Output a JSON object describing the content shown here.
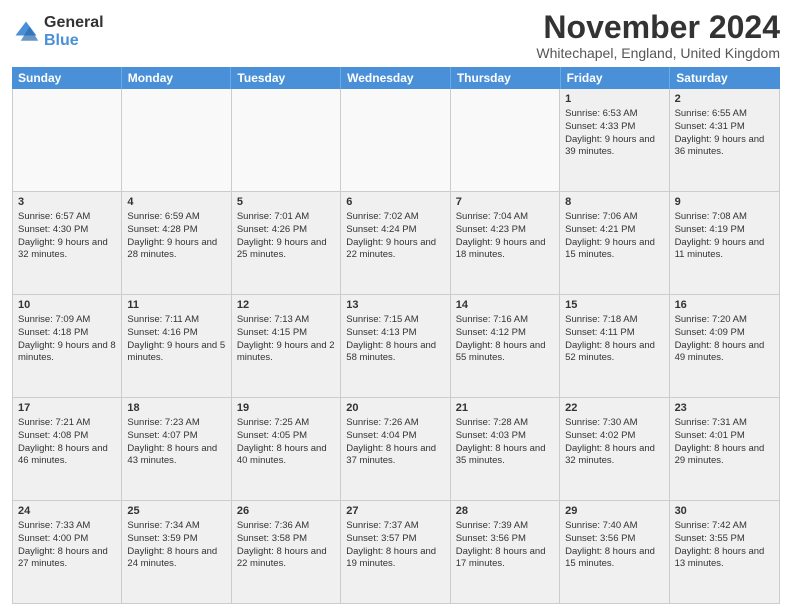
{
  "header": {
    "logo_general": "General",
    "logo_blue": "Blue",
    "month_title": "November 2024",
    "location": "Whitechapel, England, United Kingdom"
  },
  "days_of_week": [
    "Sunday",
    "Monday",
    "Tuesday",
    "Wednesday",
    "Thursday",
    "Friday",
    "Saturday"
  ],
  "weeks": [
    [
      {
        "day": "",
        "empty": true
      },
      {
        "day": "",
        "empty": true
      },
      {
        "day": "",
        "empty": true
      },
      {
        "day": "",
        "empty": true
      },
      {
        "day": "",
        "empty": true
      },
      {
        "day": "1",
        "sunrise": "6:53 AM",
        "sunset": "4:33 PM",
        "daylight": "9 hours and 39 minutes."
      },
      {
        "day": "2",
        "sunrise": "6:55 AM",
        "sunset": "4:31 PM",
        "daylight": "9 hours and 36 minutes."
      }
    ],
    [
      {
        "day": "3",
        "sunrise": "6:57 AM",
        "sunset": "4:30 PM",
        "daylight": "9 hours and 32 minutes."
      },
      {
        "day": "4",
        "sunrise": "6:59 AM",
        "sunset": "4:28 PM",
        "daylight": "9 hours and 28 minutes."
      },
      {
        "day": "5",
        "sunrise": "7:01 AM",
        "sunset": "4:26 PM",
        "daylight": "9 hours and 25 minutes."
      },
      {
        "day": "6",
        "sunrise": "7:02 AM",
        "sunset": "4:24 PM",
        "daylight": "9 hours and 22 minutes."
      },
      {
        "day": "7",
        "sunrise": "7:04 AM",
        "sunset": "4:23 PM",
        "daylight": "9 hours and 18 minutes."
      },
      {
        "day": "8",
        "sunrise": "7:06 AM",
        "sunset": "4:21 PM",
        "daylight": "9 hours and 15 minutes."
      },
      {
        "day": "9",
        "sunrise": "7:08 AM",
        "sunset": "4:19 PM",
        "daylight": "9 hours and 11 minutes."
      }
    ],
    [
      {
        "day": "10",
        "sunrise": "7:09 AM",
        "sunset": "4:18 PM",
        "daylight": "9 hours and 8 minutes."
      },
      {
        "day": "11",
        "sunrise": "7:11 AM",
        "sunset": "4:16 PM",
        "daylight": "9 hours and 5 minutes."
      },
      {
        "day": "12",
        "sunrise": "7:13 AM",
        "sunset": "4:15 PM",
        "daylight": "9 hours and 2 minutes."
      },
      {
        "day": "13",
        "sunrise": "7:15 AM",
        "sunset": "4:13 PM",
        "daylight": "8 hours and 58 minutes."
      },
      {
        "day": "14",
        "sunrise": "7:16 AM",
        "sunset": "4:12 PM",
        "daylight": "8 hours and 55 minutes."
      },
      {
        "day": "15",
        "sunrise": "7:18 AM",
        "sunset": "4:11 PM",
        "daylight": "8 hours and 52 minutes."
      },
      {
        "day": "16",
        "sunrise": "7:20 AM",
        "sunset": "4:09 PM",
        "daylight": "8 hours and 49 minutes."
      }
    ],
    [
      {
        "day": "17",
        "sunrise": "7:21 AM",
        "sunset": "4:08 PM",
        "daylight": "8 hours and 46 minutes."
      },
      {
        "day": "18",
        "sunrise": "7:23 AM",
        "sunset": "4:07 PM",
        "daylight": "8 hours and 43 minutes."
      },
      {
        "day": "19",
        "sunrise": "7:25 AM",
        "sunset": "4:05 PM",
        "daylight": "8 hours and 40 minutes."
      },
      {
        "day": "20",
        "sunrise": "7:26 AM",
        "sunset": "4:04 PM",
        "daylight": "8 hours and 37 minutes."
      },
      {
        "day": "21",
        "sunrise": "7:28 AM",
        "sunset": "4:03 PM",
        "daylight": "8 hours and 35 minutes."
      },
      {
        "day": "22",
        "sunrise": "7:30 AM",
        "sunset": "4:02 PM",
        "daylight": "8 hours and 32 minutes."
      },
      {
        "day": "23",
        "sunrise": "7:31 AM",
        "sunset": "4:01 PM",
        "daylight": "8 hours and 29 minutes."
      }
    ],
    [
      {
        "day": "24",
        "sunrise": "7:33 AM",
        "sunset": "4:00 PM",
        "daylight": "8 hours and 27 minutes."
      },
      {
        "day": "25",
        "sunrise": "7:34 AM",
        "sunset": "3:59 PM",
        "daylight": "8 hours and 24 minutes."
      },
      {
        "day": "26",
        "sunrise": "7:36 AM",
        "sunset": "3:58 PM",
        "daylight": "8 hours and 22 minutes."
      },
      {
        "day": "27",
        "sunrise": "7:37 AM",
        "sunset": "3:57 PM",
        "daylight": "8 hours and 19 minutes."
      },
      {
        "day": "28",
        "sunrise": "7:39 AM",
        "sunset": "3:56 PM",
        "daylight": "8 hours and 17 minutes."
      },
      {
        "day": "29",
        "sunrise": "7:40 AM",
        "sunset": "3:56 PM",
        "daylight": "8 hours and 15 minutes."
      },
      {
        "day": "30",
        "sunrise": "7:42 AM",
        "sunset": "3:55 PM",
        "daylight": "8 hours and 13 minutes."
      }
    ]
  ],
  "labels": {
    "sunrise": "Sunrise:",
    "sunset": "Sunset:",
    "daylight": "Daylight:"
  }
}
